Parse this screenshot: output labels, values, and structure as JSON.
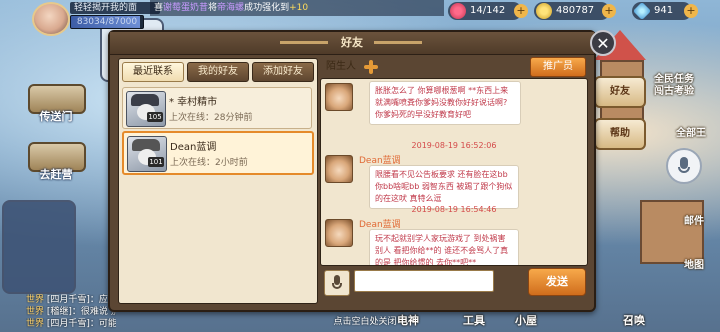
{
  "hud": {
    "player_name": "轻轻揭开我的面",
    "exp_text": "83034/87000",
    "exp_fraction": 0.954,
    "broadcast": {
      "prefix": "喜",
      "user1": "谢莓蛋奶昔",
      "mid1": "将",
      "user2": "帝海螺",
      "mid2": "成功强化到",
      "plus": "+10"
    },
    "stamina": "14/142",
    "coins": "480787",
    "gems": "941"
  },
  "left_nav": [
    "传送门",
    "去赶营"
  ],
  "chat_ticker": [
    {
      "tag": "世界",
      "text": "[四月千雪]：应"
    },
    {
      "tag": "世界",
      "text": "[稽继]：很难说 别过了"
    },
    {
      "tag": "世界",
      "text": "[四月千雪]：可能"
    }
  ],
  "right_menu": {
    "event_label1": "全民任务",
    "event_label2": "闯古考验",
    "friends": "好友",
    "help": "帮助",
    "all_label": "全部王",
    "mail": "邮件",
    "map": "地图"
  },
  "bottom_tabs": [
    "电神",
    "工具",
    "小屋",
    "召唤"
  ],
  "tap_to_close": "点击空白处关闭",
  "modal": {
    "title": "好友",
    "tabs": [
      "最近联系",
      "我的好友",
      "添加好友"
    ],
    "friends": [
      {
        "name": "* 幸村精市",
        "last_online": "上次在线：28分钟前",
        "level": "105"
      },
      {
        "name": "Dean蓝调",
        "last_online": "上次在线：2小时前",
        "level": "101"
      }
    ],
    "chat_target": "陌生人",
    "promoter_btn": "推广员",
    "messages": [
      {
        "text": "胀胀怎么了 你算哪根葱啊 **东西上来就满嘴喷粪你爹妈没教你好好说话啊? 你爹妈死的早没好教育好吧"
      },
      {
        "time": "2019-08-19 16:52:06",
        "name": "Dean蓝调",
        "text": "限腰看不见公告板要求 还有脸在这bb 你bb啥呢bb 弱智东西 被踢了跟个狗似的在这吠 真特么逗"
      },
      {
        "time": "2019-08-19 16:54:46",
        "name": "Dean蓝调",
        "text": "玩不起就别学人家玩游戏了 到处祸害别人 看把你给**的 谁还不会骂人了真的是 把你给惯的 去你**吧**"
      }
    ],
    "input_placeholder": "",
    "send_btn": "发送"
  }
}
